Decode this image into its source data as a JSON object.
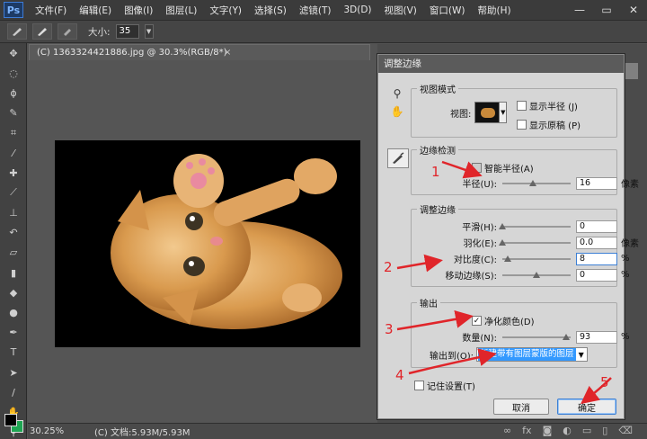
{
  "app": {
    "logo": "Ps"
  },
  "menu": [
    "文件(F)",
    "编辑(E)",
    "图像(I)",
    "图层(L)",
    "文字(Y)",
    "选择(S)",
    "滤镜(T)",
    "3D(D)",
    "视图(V)",
    "窗口(W)",
    "帮助(H)"
  ],
  "window_controls": [
    "—",
    "▭",
    "✕"
  ],
  "options_bar": {
    "size_label": "大小:",
    "size_value": "35"
  },
  "document": {
    "tab_title": "(C) 1363324421886.jpg @ 30.3%(RGB/8*)",
    "close_glyph": "×",
    "zoom": "30.25%",
    "info": "(C) 文档:5.93M/5.93M"
  },
  "colors": {
    "foreground": "#000000",
    "background": "#1ea552"
  },
  "dialog": {
    "title": "调整边缘",
    "view_mode": {
      "legend": "视图模式",
      "view_label": "视图:",
      "show_radius": "显示半径 (J)",
      "show_original": "显示原稿 (P)"
    },
    "edge_detection": {
      "legend": "边缘检测",
      "smart_radius": "智能半径(A)",
      "radius_label": "半径(U):",
      "radius_value": "16",
      "radius_unit": "像素",
      "radius_fraction": 0.45
    },
    "adjust_edge": {
      "legend": "调整边缘",
      "smooth_label": "平滑(H):",
      "smooth_value": "0",
      "smooth_fraction": 0.0,
      "feather_label": "羽化(E):",
      "feather_value": "0.0",
      "feather_unit": "像素",
      "feather_fraction": 0.0,
      "contrast_label": "对比度(C):",
      "contrast_value": "8",
      "contrast_unit": "%",
      "contrast_fraction": 0.08,
      "shift_label": "移动边缘(S):",
      "shift_value": "0",
      "shift_unit": "%",
      "shift_fraction": 0.5
    },
    "output": {
      "legend": "输出",
      "decontaminate": "净化颜色(D)",
      "amount_label": "数量(N):",
      "amount_value": "93",
      "amount_unit": "%",
      "amount_fraction": 0.93,
      "output_to_label": "输出到(O):",
      "output_to_value": "新建带有图层蒙版的图层"
    },
    "remember": "记住设置(T)",
    "cancel": "取消",
    "ok": "确定"
  },
  "annotations": [
    "1",
    "2",
    "3",
    "4",
    "5"
  ]
}
